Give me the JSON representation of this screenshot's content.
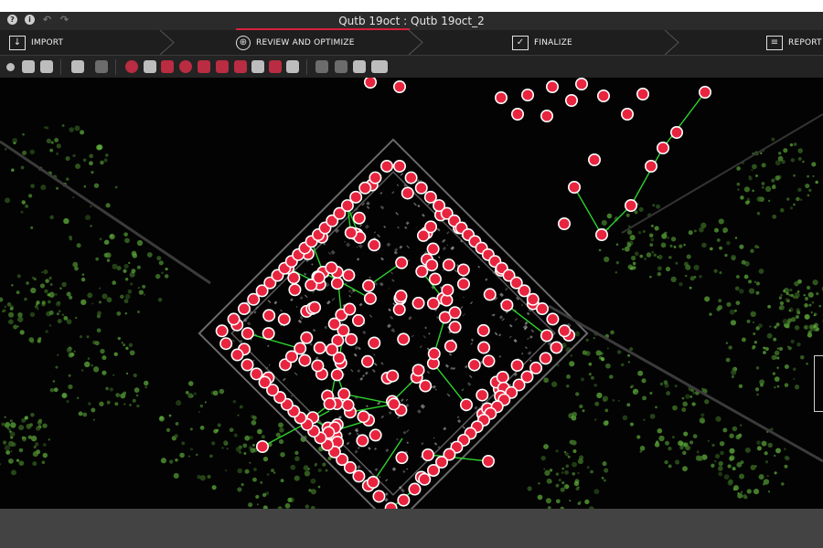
{
  "window": {
    "title": "Qutb 19oct : Qutb 19oct_2",
    "left_icons": [
      "help-icon",
      "info-icon",
      "undo-icon",
      "redo-icon"
    ]
  },
  "workflow": {
    "steps": [
      {
        "label": "IMPORT",
        "icon": "import-icon"
      },
      {
        "label": "REVIEW AND OPTIMIZE",
        "icon": "review-icon",
        "active": true
      },
      {
        "label": "FINALIZE",
        "icon": "finalize-icon"
      },
      {
        "label": "REPORT",
        "icon": "report-icon"
      }
    ]
  },
  "toolbar": {
    "icons": [
      "point-size-icon",
      "layers-icon",
      "stop-icon",
      "measure-icon",
      "select-icon",
      "target-icon",
      "tag-icon",
      "cloud-icon",
      "sphere-icon",
      "mesh-icon",
      "pencil-icon",
      "image-icon",
      "camera-icon",
      "location-pin-icon",
      "location-settings-icon",
      "shuffle-icon",
      "fit-view-icon",
      "snapshot-icon",
      "display-mode-icon"
    ]
  },
  "colors": {
    "accent": "#d5203b",
    "marker": "#e8243f",
    "link": "#2ed32e",
    "background": "#030303"
  }
}
